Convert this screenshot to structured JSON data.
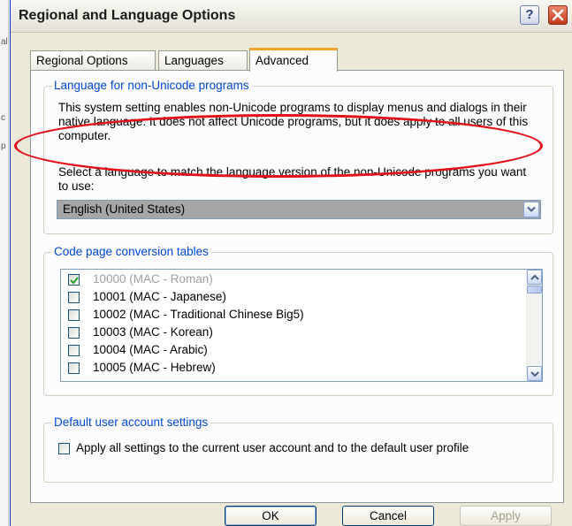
{
  "window": {
    "title": "Regional and Language Options"
  },
  "edge_glyphs": [
    "al",
    "c",
    "p"
  ],
  "tabs": [
    {
      "label": "Regional Options",
      "active": false
    },
    {
      "label": "Languages",
      "active": false
    },
    {
      "label": "Advanced",
      "active": true
    }
  ],
  "non_unicode": {
    "legend": "Language for non-Unicode programs",
    "description": "This system setting enables non-Unicode programs to display menus and dialogs in their native language. It does not affect Unicode programs, but it does apply to all users of this computer.",
    "select_prompt": "Select a language to match the language version of the non-Unicode programs you want to use:",
    "selected_language": "English (United States)"
  },
  "code_pages": {
    "legend": "Code page conversion tables",
    "items": [
      {
        "label": "10000 (MAC - Roman)",
        "checked": true,
        "disabled": true
      },
      {
        "label": "10001 (MAC - Japanese)",
        "checked": false,
        "disabled": false
      },
      {
        "label": "10002 (MAC - Traditional Chinese Big5)",
        "checked": false,
        "disabled": false
      },
      {
        "label": "10003 (MAC - Korean)",
        "checked": false,
        "disabled": false
      },
      {
        "label": "10004 (MAC - Arabic)",
        "checked": false,
        "disabled": false
      },
      {
        "label": "10005 (MAC - Hebrew)",
        "checked": false,
        "disabled": false
      }
    ]
  },
  "default_account": {
    "legend": "Default user account settings",
    "checkbox_label": "Apply all settings to the current user account and to the default user profile",
    "checked": false
  },
  "buttons": {
    "ok": "OK",
    "cancel": "Cancel",
    "apply": "Apply"
  },
  "colors": {
    "highlight_ellipse": "#e3101a",
    "group_legend": "#0046d5",
    "active_tab_accent": "#f3a42b"
  }
}
